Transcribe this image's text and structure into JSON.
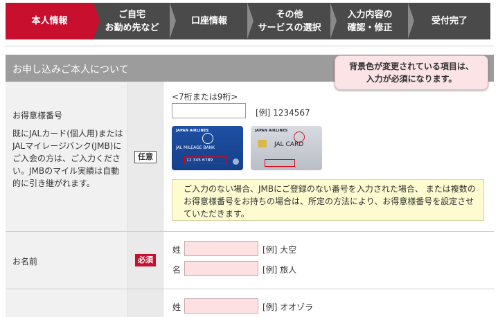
{
  "steps": [
    {
      "label": "本人情報",
      "active": true
    },
    {
      "label": "ご自宅\nお勤め先など",
      "active": false
    },
    {
      "label": "口座情報",
      "active": false
    },
    {
      "label": "その他\nサービスの選択",
      "active": false
    },
    {
      "label": "入力内容の\n確認・修正",
      "active": false
    },
    {
      "label": "受付完了",
      "active": false
    }
  ],
  "section": {
    "title": "お申し込みご本人について",
    "notice": "背景色が変更されている項目は、\n入力が必須になります。"
  },
  "membership": {
    "title": "お得意様番号",
    "description": "既にJALカード(個人用)またはJALマイレージバンク(JMB)にご入会の方は、ご入力ください。JMBのマイル実績は自動的に引き継がれます。",
    "badge": "任意",
    "hint": "<7桁または9桁>",
    "value": "",
    "example": "[例] 1234567",
    "card_blue": {
      "brand": "JAPAN AIRLINES",
      "name": "JAL MILEAGE BANK",
      "number": "12 345 6789"
    },
    "card_silver": {
      "brand": "JAPAN AIRLINES",
      "name": "JAL CARD"
    },
    "info": "ご入力のない場合、JMBにご登録のない番号を入力された場合、 または複数のお得意様番号をお持ちの場合は、所定の方法により、お得意様番号を設定させていただきます。"
  },
  "name": {
    "title": "お名前",
    "badge": "必須",
    "last_label": "姓",
    "last_value": "",
    "last_example": "[例] 大空",
    "first_label": "名",
    "first_value": "",
    "first_example": "[例] 旅人"
  },
  "kana": {
    "last_label": "姓",
    "last_example": "[例] オオゾラ"
  },
  "colors": {
    "active_step": "#c8102e",
    "step_bar": "#4a4a4a",
    "required_input": "#fde0e2",
    "info_box": "#fffbd0"
  }
}
